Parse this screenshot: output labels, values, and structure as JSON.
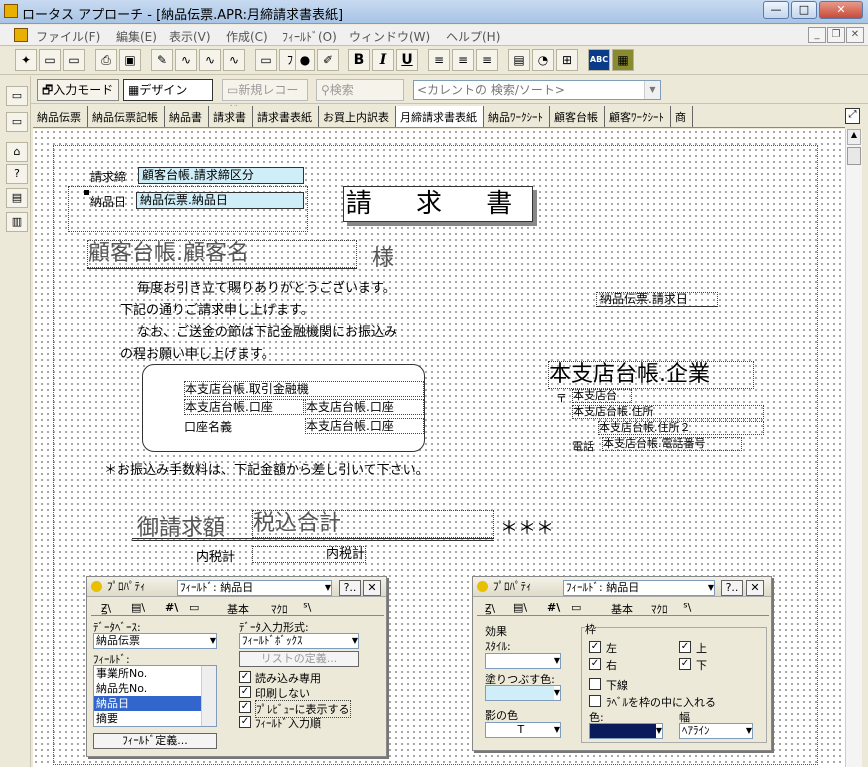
{
  "window": {
    "title": "ロータス アプローチ - [納品伝票.APR:月締請求書表紙]"
  },
  "menu": {
    "items": [
      "ファイル(F)",
      "編集(E)",
      "表示(V)",
      "作成(C)",
      "ﾌｨｰﾙﾄﾞ(O)",
      "ウィンドウ(W)",
      "ヘルプ(H)"
    ]
  },
  "toolbar": {
    "bold": "B",
    "italic": "I",
    "underline": "U",
    "abc": "ABC"
  },
  "toolbar2": {
    "input_mode": "入力モード",
    "design": "デザイン",
    "new_record": "新規レコード",
    "search": "検索",
    "search_placeholder": "<カレントの 検索/ソート>"
  },
  "tabs": [
    "納品伝票",
    "納品伝票記帳",
    "納品書",
    "請求書",
    "請求書表紙",
    "お買上内訳表",
    "月締請求書表紙",
    "納品ﾜｰｸｼｰﾄ",
    "顧客台帳",
    "顧客ﾜｰｸｼｰﾄ",
    "商"
  ],
  "form": {
    "label_seikyu_shime": "請求締",
    "field_seikyu_shime": "顧客台帳.請求締区分",
    "label_nohin_date": "納品日",
    "field_nohin_date": "納品伝票.納品日",
    "title": "請 求 書",
    "field_customer": "顧客台帳.顧客名",
    "sama": "様",
    "greeting1": "毎度お引き立て賜りありがとうございます。",
    "greeting2": "下記の通りご請求申し上げます。",
    "greeting3": "なお、ご送金の節は下記金融機関にお振込み",
    "greeting4": "の程お願い申し上げます。",
    "field_seikyu_date": "納品伝票.請求日",
    "field_company": "本支店台帳.企業",
    "postal_mark": "〒",
    "field_branch": "本支店台",
    "field_address1": "本支店台帳.住所",
    "field_address2": "本支店台帳.住所２",
    "label_tel": "電話",
    "field_tel": "本支店台帳.電話番号",
    "field_bank": "本支店台帳.取引金融機",
    "field_account_type": "本支店台帳.口座",
    "field_account_no": "本支店台帳.口座",
    "label_account_name": "口座名義",
    "field_account_name": "本支店台帳.口座",
    "fee_note": "＊お振込み手数料は、下記金額から差し引いて下さい。",
    "total_label": "御請求額",
    "field_total": "税込合計",
    "stars": "＊＊＊",
    "tax_label": "内税計",
    "field_tax": "内税計"
  },
  "panel1": {
    "title": "ﾌﾟﾛﾊﾟﾃｨ",
    "field_select": "ﾌｨｰﾙﾄﾞ: 納品日",
    "help_btn": "?..",
    "close_btn": "✕",
    "tabs": [
      "基本",
      "ﾏｸﾛ"
    ],
    "db_label": "ﾃﾞｰﾀﾍﾞｰｽ:",
    "db_value": "納品伝票",
    "field_label": "ﾌｨｰﾙﾄﾞ:",
    "field_list": [
      "事業所No.",
      "納品先No.",
      "納品日",
      "摘要"
    ],
    "selected_index": 2,
    "input_format_label": "ﾃﾞｰﾀ入力形式:",
    "input_format_value": "ﾌｨｰﾙﾄﾞﾎﾞｯｸｽ",
    "list_define_btn": "リストの定義...",
    "checks": [
      "読み込み専用",
      "印刷しない",
      "ﾌﾟﾚﾋﾞｭｰに表示する",
      "ﾌｨｰﾙﾄﾞ入力順"
    ],
    "field_define_btn": "ﾌｨｰﾙﾄﾞ定義..."
  },
  "panel2": {
    "title": "ﾌﾟﾛﾊﾟﾃｨ",
    "field_select": "ﾌｨｰﾙﾄﾞ: 納品日",
    "help_btn": "?..",
    "close_btn": "✕",
    "tabs": [
      "基本",
      "ﾏｸﾛ"
    ],
    "effect_label": "効果",
    "style_label": "ｽﾀｲﾙ:",
    "fill_label": "塗りつぶす色:",
    "shadow_label": "影の色",
    "shadow_value": "T",
    "frame_label": "枠",
    "frame_checks": [
      "左",
      "上",
      "右",
      "下"
    ],
    "underline_label": "下線",
    "label_in_frame": "ﾗﾍﾞﾙを枠の中に入れる",
    "color_label": "色:",
    "width_label": "幅",
    "width_value": "ﾍｱﾗｲﾝ"
  }
}
